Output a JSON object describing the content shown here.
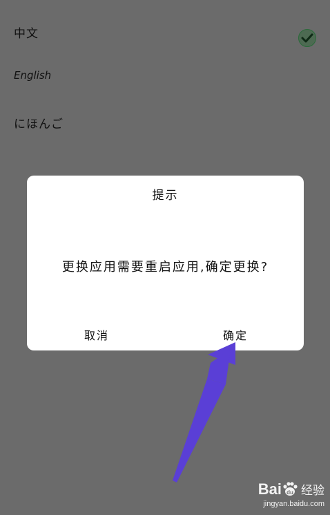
{
  "languages": [
    {
      "label": "中文",
      "selected": true
    },
    {
      "label": "English",
      "selected": false
    },
    {
      "label": "にほんご",
      "selected": false
    }
  ],
  "dialog": {
    "title": "提示",
    "message": "更换应用需要重启应用,确定更换?",
    "cancel_label": "取消",
    "ok_label": "确定"
  },
  "annotation": {
    "arrow_color": "#5a3fd6",
    "icon": "arrow-pointer-icon"
  },
  "watermark": {
    "brand_latin": "Bai",
    "brand_latin_suffix": "du",
    "brand_cn": "经验",
    "url": "jingyan.baidu.com"
  },
  "colors": {
    "overlay": "#6b6b6b",
    "dialog_bg": "#ffffff",
    "check": "#4d6a52"
  }
}
